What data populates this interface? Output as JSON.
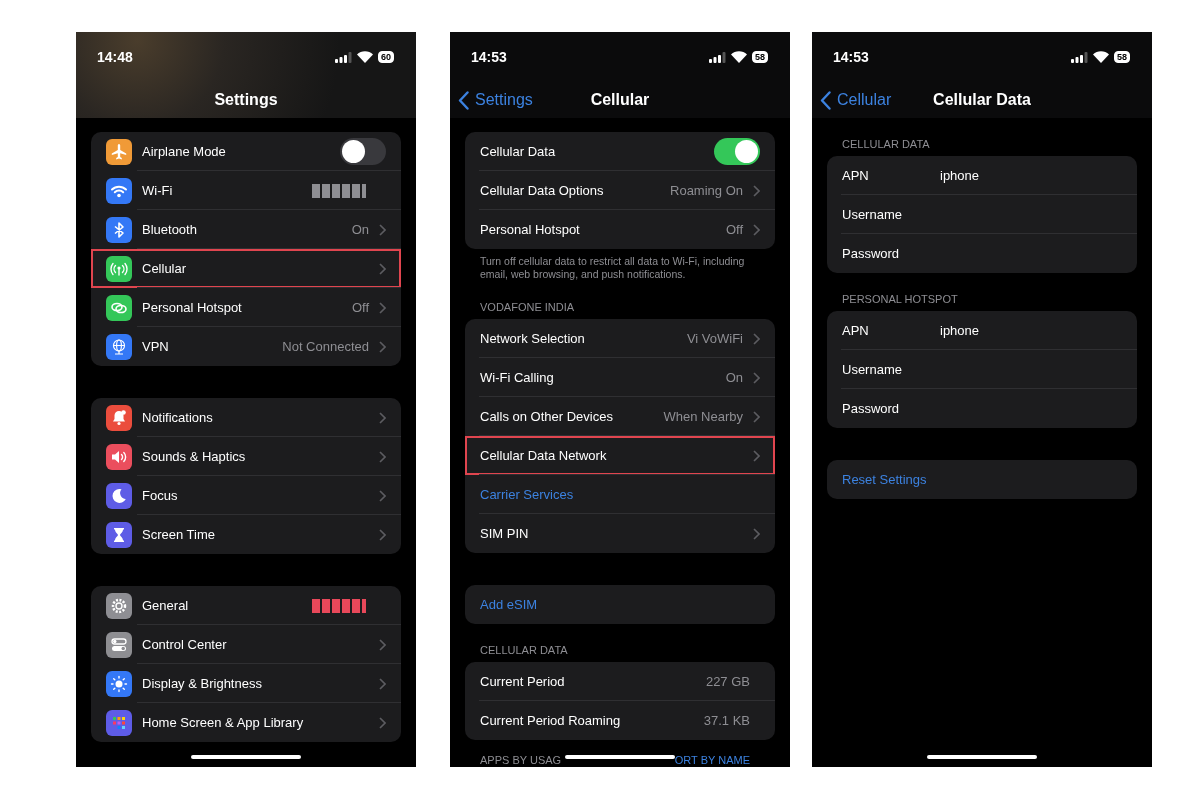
{
  "screens": [
    {
      "status_bar": {
        "time": "14:48",
        "battery": "60"
      },
      "nav": {
        "translucent": true,
        "title": "Settings"
      },
      "groups": [
        {
          "kind": "card",
          "rows": [
            {
              "kind": "toggle",
              "label": "Airplane Mode",
              "on": false,
              "color": "#f09a37",
              "highlighted": false
            },
            {
              "kind": "redacted",
              "label": "Wi-Fi",
              "color": "#3478f6",
              "block": {
                "color": "#8e8e93"
              },
              "highlighted": false
            },
            {
              "kind": "nav",
              "label": "Bluetooth",
              "value": "On",
              "color": "#3478f6",
              "highlighted": false
            },
            {
              "kind": "nav",
              "label": "Cellular",
              "color": "#34c759",
              "highlighted": true
            },
            {
              "kind": "nav",
              "label": "Personal Hotspot",
              "value": "Off",
              "color": "#34c759",
              "highlighted": false
            },
            {
              "kind": "nav",
              "label": "VPN",
              "value": "Not Connected",
              "color": "#3478f6",
              "highlighted": false
            }
          ]
        },
        {
          "kind": "card",
          "rows": [
            {
              "kind": "nav",
              "label": "Notifications",
              "color": "#eb4d3d",
              "highlighted": false
            },
            {
              "kind": "nav",
              "label": "Sounds & Haptics",
              "color": "#eb4e5d",
              "highlighted": false
            },
            {
              "kind": "nav",
              "label": "Focus",
              "color": "#5e5ce6",
              "highlighted": false
            },
            {
              "kind": "nav",
              "label": "Screen Time",
              "color": "#5e5ce6",
              "highlighted": false
            }
          ]
        },
        {
          "kind": "card",
          "rows": [
            {
              "kind": "redacted",
              "label": "General",
              "color": "#8e8e93",
              "block": {
                "color": "#e8485a"
              },
              "highlighted": false
            },
            {
              "kind": "nav",
              "label": "Control Center",
              "color": "#8e8e92",
              "highlighted": false
            },
            {
              "kind": "nav",
              "label": "Display & Brightness",
              "color": "#3478f7",
              "highlighted": false
            },
            {
              "kind": "nav",
              "label": "Home Screen & App Library",
              "color": "#5e5ce7",
              "highlighted": false
            }
          ]
        }
      ]
    },
    {
      "status_bar": {
        "time": "14:53",
        "battery": "58"
      },
      "nav": {
        "translucent": false,
        "back": "Settings",
        "title": "Cellular"
      },
      "groups": [
        {
          "kind": "card",
          "rows": [
            {
              "kind": "toggle",
              "label": "Cellular Data",
              "on": true,
              "highlighted": false
            },
            {
              "kind": "nav",
              "label": "Cellular Data Options",
              "value": "Roaming On",
              "highlighted": false
            },
            {
              "kind": "nav",
              "label": "Personal Hotspot",
              "value": "Off",
              "highlighted": false
            }
          ],
          "footer": "Turn off cellular data to restrict all data to Wi-Fi, including email, web browsing, and push notifications."
        },
        {
          "kind": "card",
          "header": "VODAFONE INDIA",
          "rows": [
            {
              "kind": "nav",
              "label": "Network Selection",
              "value": "Vi VoWiFi",
              "highlighted": false
            },
            {
              "kind": "nav",
              "label": "Wi-Fi Calling",
              "value": "On",
              "highlighted": false
            },
            {
              "kind": "nav",
              "label": "Calls on Other Devices",
              "value": "When Nearby",
              "highlighted": false
            },
            {
              "kind": "nav",
              "label": "Cellular Data Network",
              "highlighted": true
            },
            {
              "kind": "link",
              "label": "Carrier Services",
              "highlighted": false
            },
            {
              "kind": "nav",
              "label": "SIM PIN",
              "highlighted": false
            }
          ]
        },
        {
          "kind": "card",
          "rows": [
            {
              "kind": "link",
              "label": "Add eSIM",
              "highlighted": false
            }
          ]
        },
        {
          "kind": "card",
          "header": "CELLULAR DATA",
          "rows": [
            {
              "kind": "stat",
              "label": "Current Period",
              "value": "227 GB",
              "highlighted": false
            },
            {
              "kind": "stat",
              "label": "Current Period Roaming",
              "value": "37.1 KB",
              "highlighted": false
            }
          ]
        },
        {
          "kind": "sort_header",
          "left": "APPS BY USAG",
          "right": "ORT BY NAME"
        }
      ]
    },
    {
      "status_bar": {
        "time": "14:53",
        "battery": "58"
      },
      "nav": {
        "translucent": false,
        "back": "Cellular",
        "title": "Cellular Data"
      },
      "groups": [
        {
          "kind": "card",
          "header": "CELLULAR DATA",
          "rows": [
            {
              "kind": "field",
              "label": "APN",
              "value": "iphone",
              "highlighted": false
            },
            {
              "kind": "field",
              "label": "Username",
              "highlighted": false
            },
            {
              "kind": "field",
              "label": "Password",
              "highlighted": false
            }
          ]
        },
        {
          "kind": "card",
          "header": "PERSONAL HOTSPOT",
          "rows": [
            {
              "kind": "field",
              "label": "APN",
              "value": "iphone",
              "highlighted": false
            },
            {
              "kind": "field",
              "label": "Username",
              "highlighted": false
            },
            {
              "kind": "field",
              "label": "Password",
              "highlighted": false
            }
          ]
        },
        {
          "kind": "card",
          "rows": [
            {
              "kind": "link",
              "label": "Reset Settings",
              "highlighted": false
            }
          ]
        }
      ]
    }
  ]
}
